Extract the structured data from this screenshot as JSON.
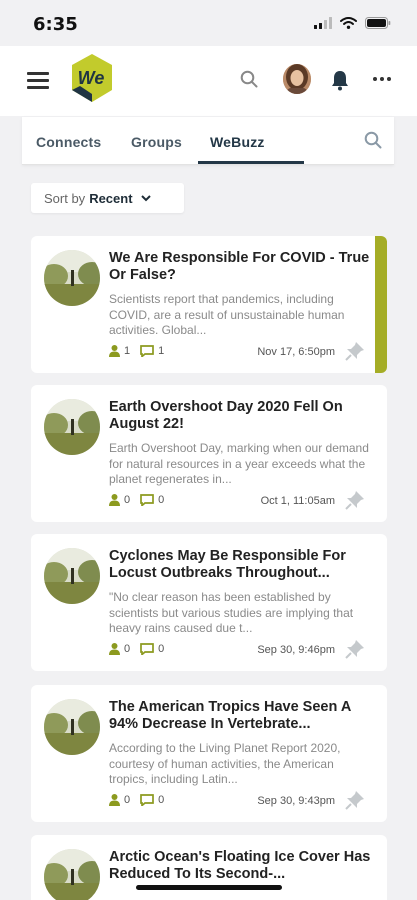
{
  "status_bar": {
    "time": "6:35"
  },
  "header": {
    "logo_text": "We"
  },
  "tabs": [
    {
      "label": "Connects"
    },
    {
      "label": "Groups"
    },
    {
      "label": "WeBuzz"
    }
  ],
  "sort": {
    "prefix": "Sort by",
    "value": "Recent"
  },
  "colors": {
    "accent": "#a5ad26",
    "navy": "#243847",
    "icon_green": "#8c9a1f"
  },
  "posts": [
    {
      "title": "We Are Responsible For COVID - True Or False?",
      "excerpt": "Scientists report that pandemics, including COVID, are a result of unsustainable human activities. Global...",
      "people_count": "1",
      "comment_count": "1",
      "date": "Nov 17, 6:50pm"
    },
    {
      "title": "Earth Overshoot Day 2020 Fell On August 22!",
      "excerpt": "Earth Overshoot Day, marking when our demand for natural resources in a year exceeds what the planet regenerates in...",
      "people_count": "0",
      "comment_count": "0",
      "date": "Oct 1, 11:05am"
    },
    {
      "title": "Cyclones May Be Responsible For Locust Outbreaks Throughout...",
      "excerpt": "\"No clear reason has been established by scientists but various studies are implying that heavy rains caused due t...",
      "people_count": "0",
      "comment_count": "0",
      "date": "Sep 30, 9:46pm"
    },
    {
      "title": "The American Tropics Have Seen A 94% Decrease In Vertebrate...",
      "excerpt": "According to the Living Planet Report 2020, courtesy of human activities, the American tropics, including Latin...",
      "people_count": "0",
      "comment_count": "0",
      "date": "Sep 30, 9:43pm"
    },
    {
      "title": "Arctic Ocean's Floating Ice Cover Has Reduced To Its Second-...",
      "excerpt": "",
      "people_count": "",
      "comment_count": "",
      "date": ""
    }
  ]
}
